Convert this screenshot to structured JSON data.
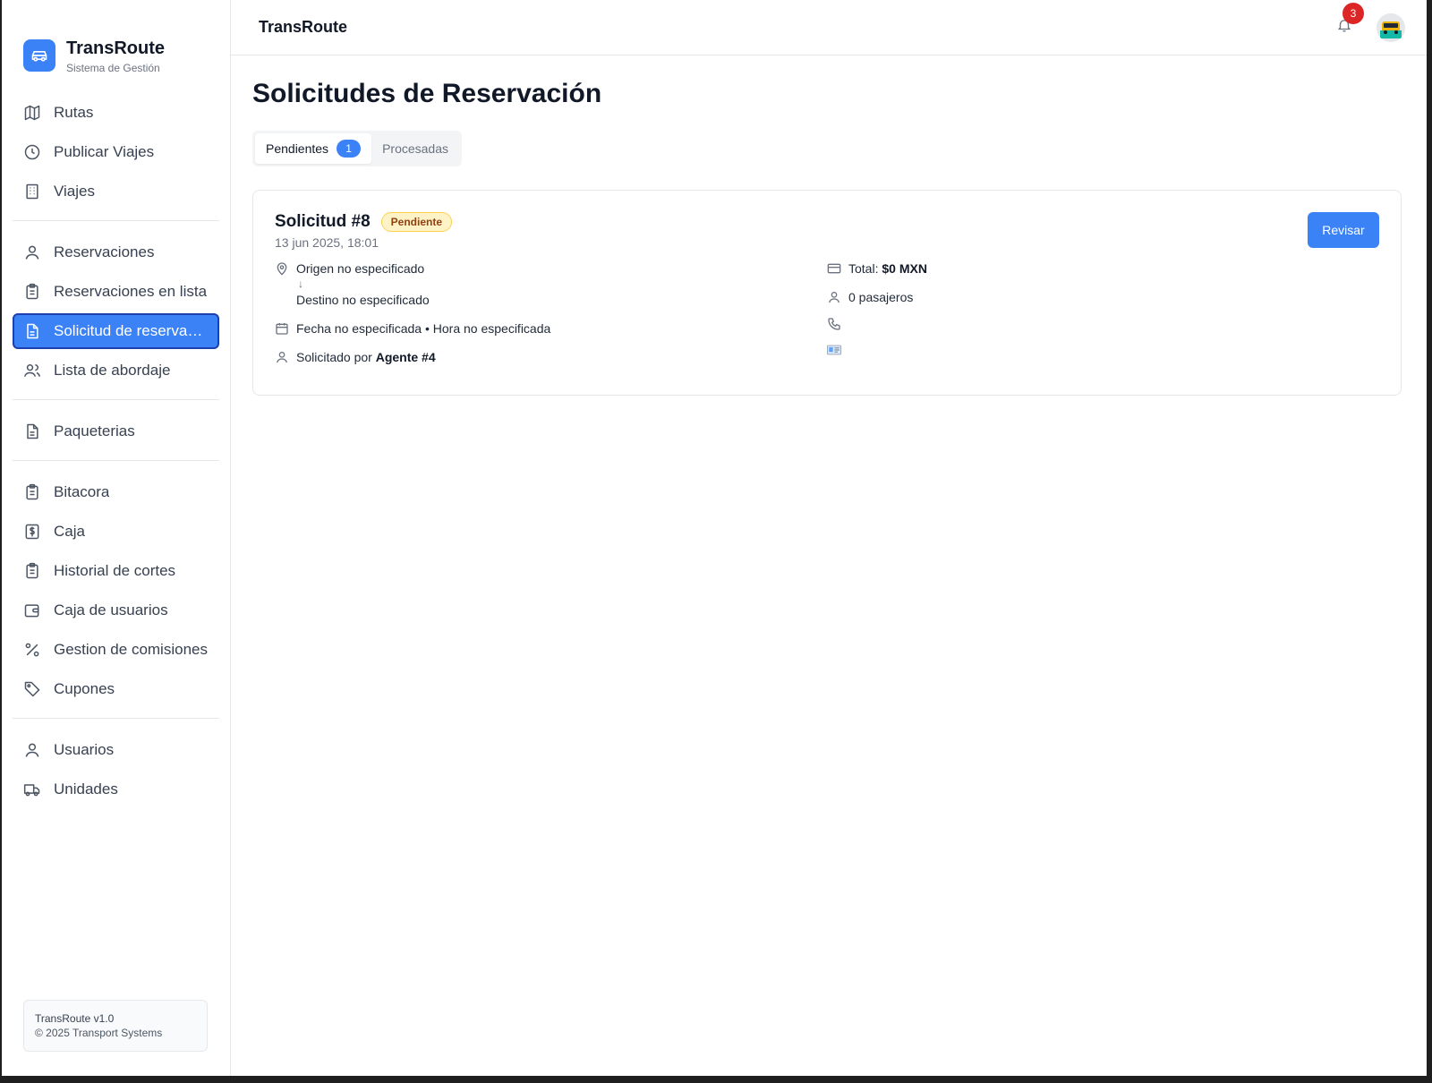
{
  "brand": {
    "name": "TransRoute",
    "subtitle": "Sistema de Gestión"
  },
  "sidebar": {
    "groups": [
      [
        {
          "label": "Rutas",
          "icon": "map-icon"
        },
        {
          "label": "Publicar Viajes",
          "icon": "clock-icon"
        },
        {
          "label": "Viajes",
          "icon": "building-icon"
        }
      ],
      [
        {
          "label": "Reservaciones",
          "icon": "user-icon"
        },
        {
          "label": "Reservaciones en lista",
          "icon": "clipboard-icon"
        },
        {
          "label": "Solicitud de reservaci...",
          "icon": "document-icon",
          "active": true
        },
        {
          "label": "Lista de abordaje",
          "icon": "users-icon"
        }
      ],
      [
        {
          "label": "Paqueterias",
          "icon": "document-icon"
        }
      ],
      [
        {
          "label": "Bitacora",
          "icon": "clipboard-icon"
        },
        {
          "label": "Caja",
          "icon": "dollar-icon"
        },
        {
          "label": "Historial de cortes",
          "icon": "clipboard-icon"
        },
        {
          "label": "Caja de usuarios",
          "icon": "wallet-icon"
        },
        {
          "label": "Gestion de comisiones",
          "icon": "percent-icon"
        },
        {
          "label": "Cupones",
          "icon": "tag-icon"
        }
      ],
      [
        {
          "label": "Usuarios",
          "icon": "user-icon"
        },
        {
          "label": "Unidades",
          "icon": "truck-icon"
        }
      ]
    ],
    "footer": {
      "version": "TransRoute v1.0",
      "copyright": "© 2025 Transport Systems"
    }
  },
  "topbar": {
    "title": "TransRoute",
    "notifications": "3"
  },
  "page": {
    "title": "Solicitudes de Reservación",
    "tabs": {
      "pending_label": "Pendientes",
      "pending_count": "1",
      "processed_label": "Procesadas"
    }
  },
  "request": {
    "title": "Solicitud #8",
    "status": "Pendiente",
    "date": "13 jun 2025, 18:01",
    "review_label": "Revisar",
    "origin": "Origen no especificado",
    "destination": "Destino no especificado",
    "arrow": "↓",
    "schedule": "Fecha no especificada • Hora no especificada",
    "requested_by_prefix": "Solicitado por",
    "requested_by": "Agente #4",
    "total_prefix": "Total:",
    "total": "$0 MXN",
    "passengers": "0 pasajeros"
  },
  "colors": {
    "accent": "#3b82f6",
    "badge_red": "#dc2626",
    "pending_bg": "#fef3c7"
  }
}
